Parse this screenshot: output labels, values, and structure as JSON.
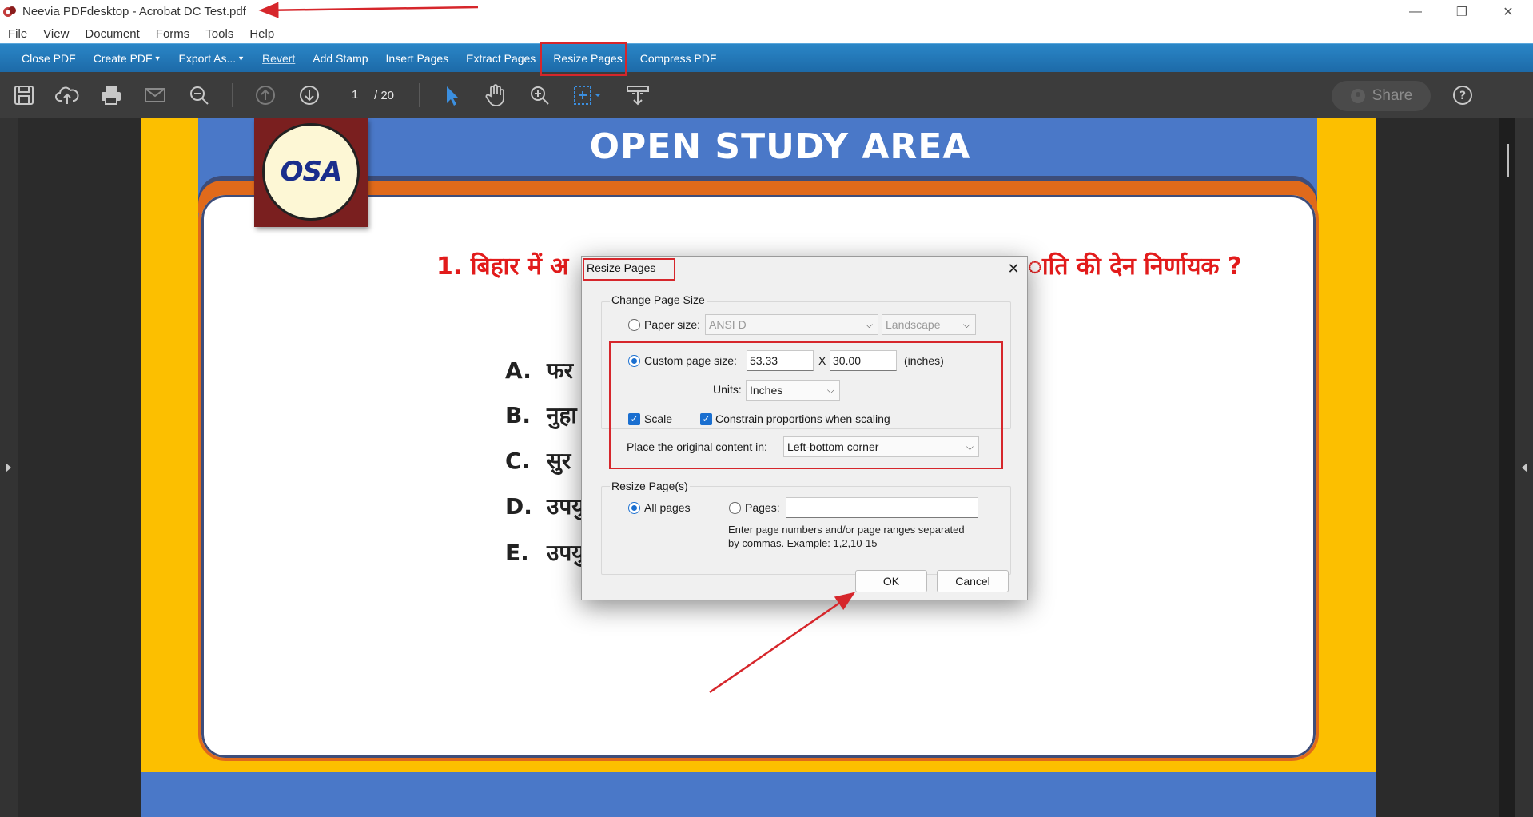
{
  "window": {
    "title": "Neevia PDFdesktop - Acrobat DC Test.pdf",
    "minimize_glyph": "—",
    "restore_glyph": "❐",
    "close_glyph": "✕"
  },
  "menu": [
    "File",
    "View",
    "Document",
    "Forms",
    "Tools",
    "Help"
  ],
  "commands": {
    "close_pdf": "Close PDF",
    "create_pdf": "Create PDF",
    "export_as": "Export As...",
    "revert": "Revert",
    "add_stamp": "Add Stamp",
    "insert_pages": "Insert Pages",
    "extract_pages": "Extract Pages",
    "resize_pages": "Resize Pages",
    "compress_pdf": "Compress PDF"
  },
  "toolbar": {
    "current_page": "1",
    "total_pages": "/ 20",
    "share_label": "Share"
  },
  "slide": {
    "logo_text": "OSA",
    "title": "OPEN STUDY AREA",
    "question_left": "1.  बिहार में अ",
    "question_right": "ाति की देन निर्णायक  ?",
    "options": [
      {
        "letter": "A.",
        "text": "फर"
      },
      {
        "letter": "B.",
        "text": "नुहा"
      },
      {
        "letter": "C.",
        "text": "सुर"
      },
      {
        "letter": "D.",
        "text": "उपयु"
      },
      {
        "letter": "E.",
        "text": "उपयु"
      }
    ]
  },
  "dialog": {
    "title": "Resize Pages",
    "close_glyph": "✕",
    "change_group": "Change Page Size",
    "paper_size_label": "Paper size:",
    "paper_size_value": "ANSI D",
    "orientation_value": "Landscape",
    "custom_label": "Custom page size:",
    "width_value": "53.33",
    "x_label": "X",
    "height_value": "30.00",
    "unit_suffix": "(inches)",
    "units_label": "Units:",
    "units_value": "Inches",
    "scale_label": "Scale",
    "constrain_label": "Constrain proportions when scaling",
    "place_label": "Place the original content in:",
    "place_value": "Left-bottom corner",
    "resize_group": "Resize Page(s)",
    "all_pages_label": "All pages",
    "pages_label": "Pages:",
    "pages_value": "",
    "hint_line1": "Enter page numbers and/or page ranges separated",
    "hint_line2": "by commas. Example: 1,2,10-15",
    "ok_label": "OK",
    "cancel_label": "Cancel"
  },
  "colors": {
    "accent_blue": "#1a6fd0",
    "annotation_red": "#d6262b",
    "command_bar": "#2a86c7",
    "slide_yellow": "#fcbf00",
    "slide_blue": "#4a78c8"
  }
}
